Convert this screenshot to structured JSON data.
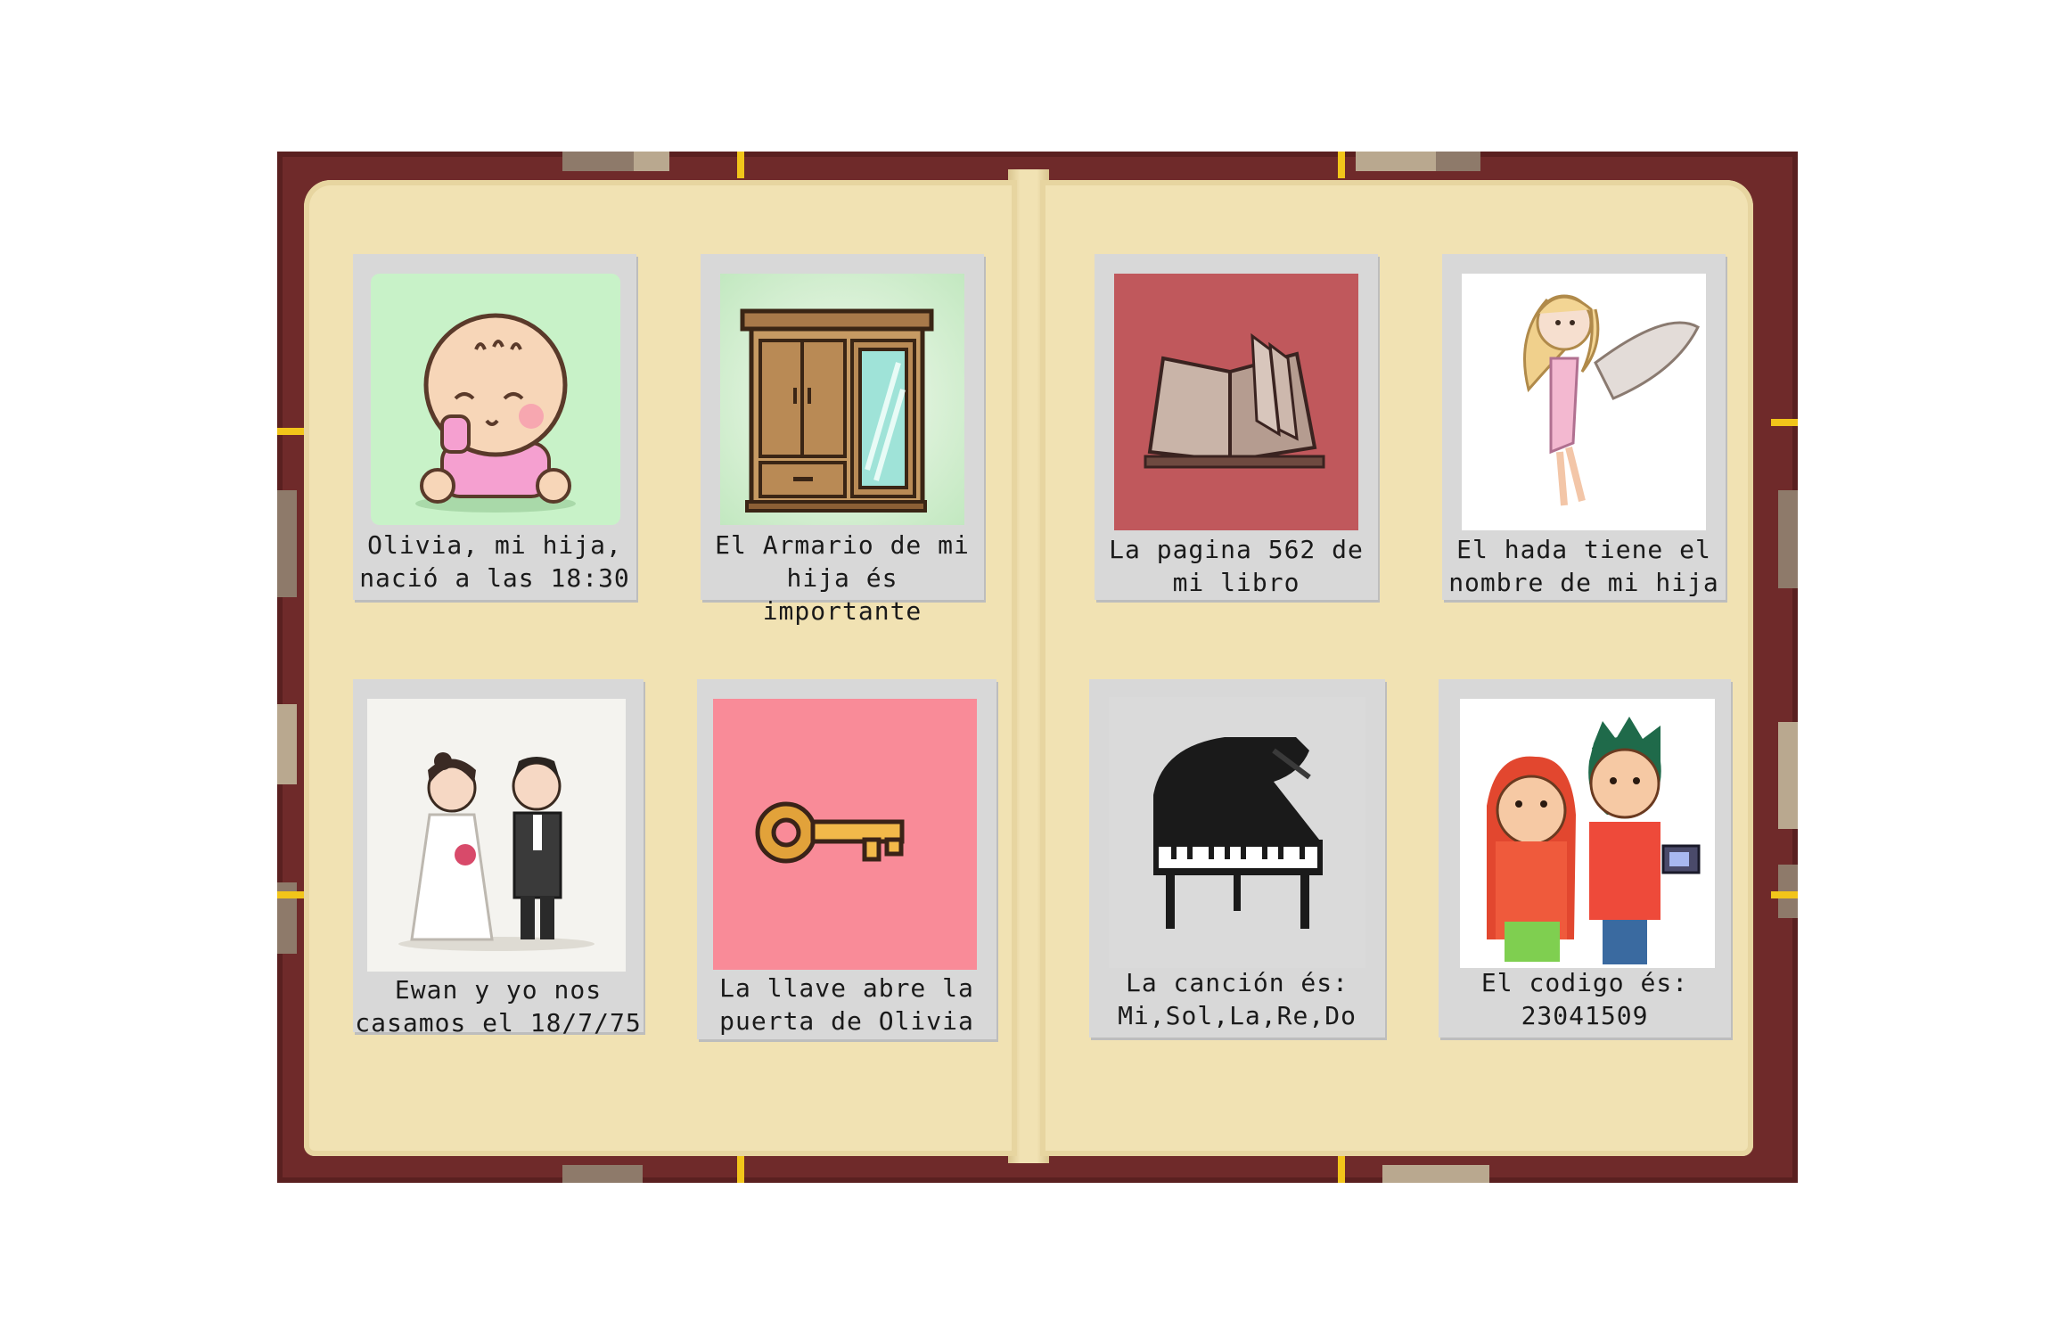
{
  "colors": {
    "cover": "#6f2a2a",
    "page": "#f1e2b3",
    "card": "#d8d8d8",
    "accent_gold": "#f2c51a"
  },
  "cards": [
    {
      "icon": "baby-icon",
      "caption": "Olivia, mi hija,\nnació a las 18:30"
    },
    {
      "icon": "wardrobe-icon",
      "caption": "El Armario de mi\nhija és importante"
    },
    {
      "icon": "open-book-icon",
      "caption": "La pagina 562 de\nmi libro"
    },
    {
      "icon": "fairy-icon",
      "caption": "El hada tiene el\nnombre de mi hija"
    },
    {
      "icon": "wedding-couple-icon",
      "caption": "Ewan y yo nos\ncasamos el 18/7/75"
    },
    {
      "icon": "key-icon",
      "caption": "La llave abre la\npuerta de Olivia"
    },
    {
      "icon": "piano-icon",
      "caption": "La canción és:\nMi,Sol,La,Re,Do"
    },
    {
      "icon": "couple-camera-icon",
      "caption": "El codigo és:\n23041509"
    }
  ]
}
